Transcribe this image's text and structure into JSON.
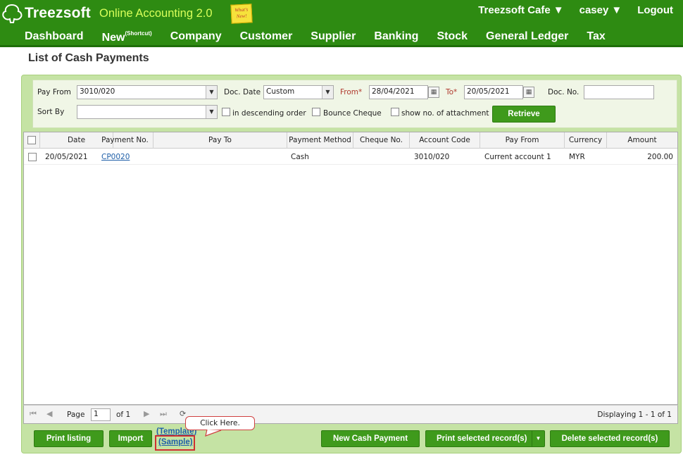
{
  "app": {
    "brand": "Treezsoft",
    "subtitle": "Online Accounting 2.0",
    "whats_new": "What's New!",
    "company": "Treezsoft Cafe",
    "user": "casey",
    "logout": "Logout"
  },
  "nav": {
    "dashboard": "Dashboard",
    "new": "New",
    "new_sup": "(Shortcut)",
    "company": "Company",
    "customer": "Customer",
    "supplier": "Supplier",
    "banking": "Banking",
    "stock": "Stock",
    "general_ledger": "General Ledger",
    "tax": "Tax"
  },
  "page": {
    "title": "List of Cash Payments"
  },
  "filters": {
    "pay_from_label": "Pay From",
    "pay_from_value": "3010/020",
    "doc_date_label": "Doc. Date",
    "doc_date_value": "Custom",
    "from_label": "From*",
    "from_value": "28/04/2021",
    "to_label": "To*",
    "to_value": "20/05/2021",
    "doc_no_label": "Doc. No.",
    "doc_no_value": "",
    "sort_by_label": "Sort By",
    "sort_by_value": "",
    "descending_label": "in descending order",
    "bounce_label": "Bounce Cheque",
    "attachment_label": "show no. of attachment",
    "retrieve": "Retrieve"
  },
  "table": {
    "columns": [
      "Date",
      "Payment No.",
      "Pay To",
      "Payment Method",
      "Cheque No.",
      "Account Code",
      "Pay From",
      "Currency",
      "Amount"
    ],
    "rows": [
      [
        "20/05/2021",
        "CP0020",
        "",
        "Cash",
        "",
        "3010/020",
        "Current account 1",
        "MYR",
        "200.00"
      ]
    ]
  },
  "pager": {
    "page_label": "Page",
    "page_value": "1",
    "of_label": "of 1",
    "displaying": "Displaying 1 - 1 of 1"
  },
  "footer": {
    "print_listing": "Print listing",
    "import": "Import",
    "template": "(Template)",
    "sample": "(Sample)",
    "callout": "Click Here.",
    "new_cash_payment": "New Cash Payment",
    "print_selected": "Print selected record(s)",
    "delete_selected": "Delete selected record(s)"
  },
  "colors": {
    "header_green": "#2e8b12",
    "accent_yellow": "#d8ff5a",
    "button_green": "#3f9a1c",
    "panel_green": "#c5e3a4"
  }
}
